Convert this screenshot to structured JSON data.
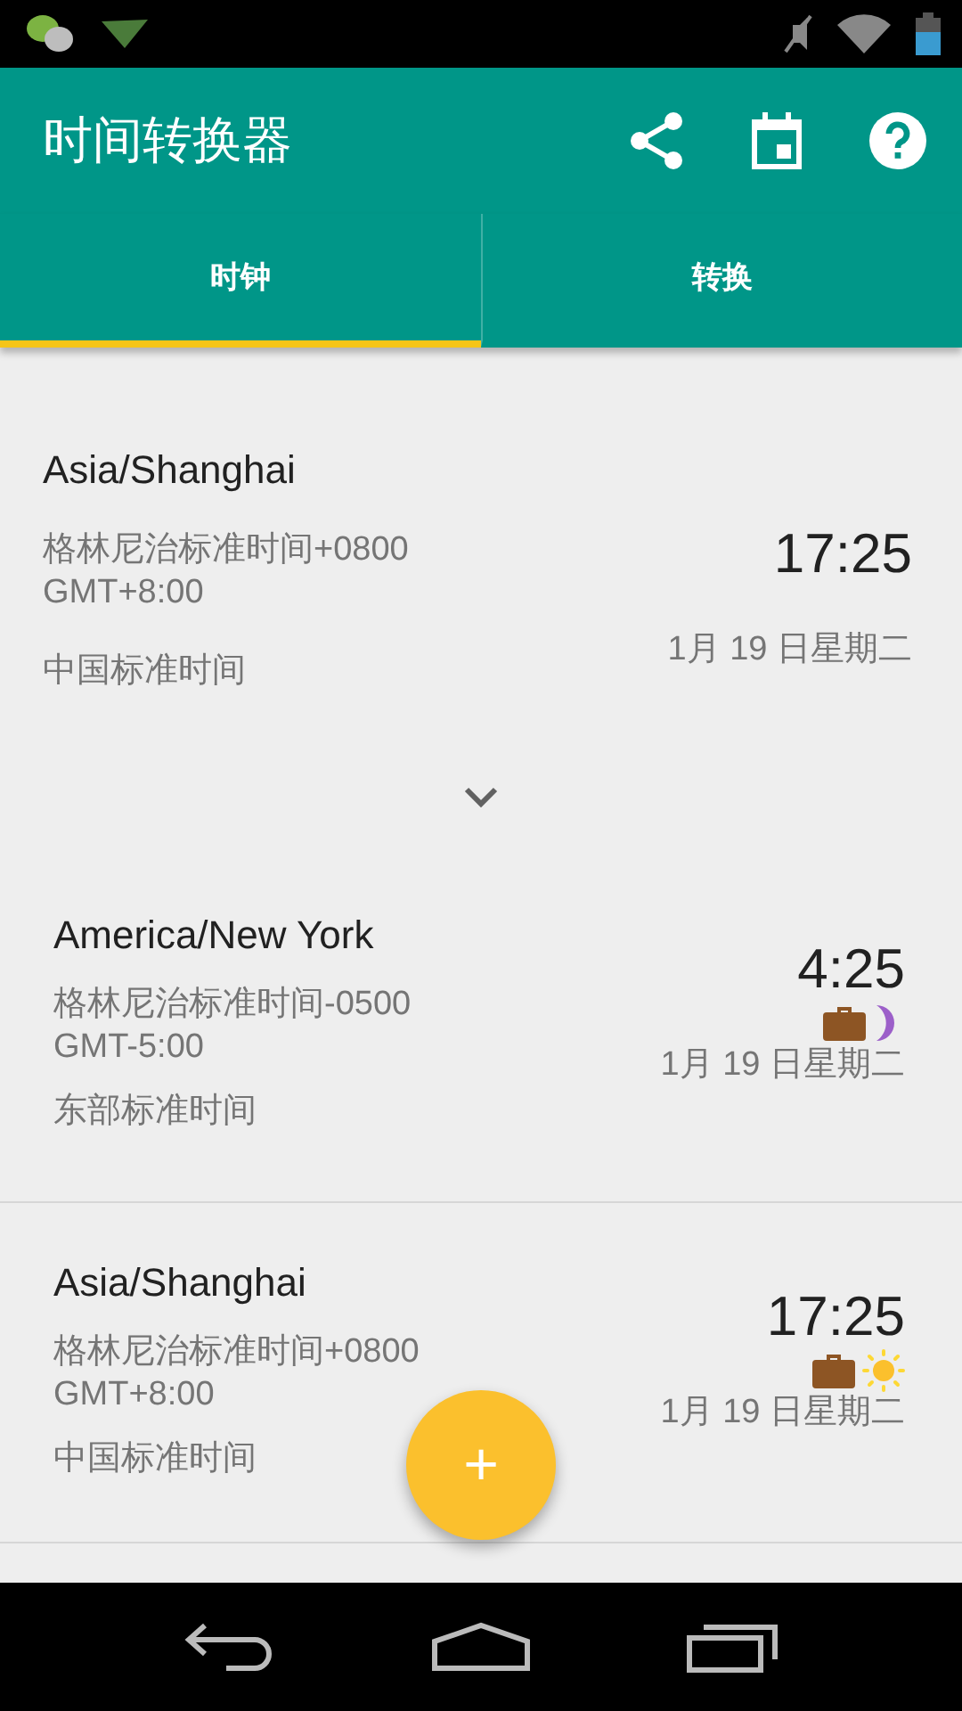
{
  "app_bar": {
    "title": "时间转换器"
  },
  "tabs": [
    {
      "label": "时钟",
      "selected": true
    },
    {
      "label": "转换",
      "selected": false
    }
  ],
  "home_clock": {
    "zone": "Asia/Shanghai",
    "offset": "格林尼治标准时间+0800",
    "gmt": "GMT+8:00",
    "zone_name": "中国标准时间",
    "time": "17:25",
    "date": "1月 19 日星期二",
    "expanded": false
  },
  "clocks": [
    {
      "zone": "America/New York",
      "offset": "格林尼治标准时间-0500",
      "gmt": "GMT-5:00",
      "zone_name": "东部标准时间",
      "time": "4:25",
      "date": "1月 19 日星期二",
      "work_hours": true,
      "daytime": false
    },
    {
      "zone": "Asia/Shanghai",
      "offset": "格林尼治标准时间+0800",
      "gmt": "GMT+8:00",
      "zone_name": "中国标准时间",
      "time": "17:25",
      "date": "1月 19 日星期二",
      "work_hours": true,
      "daytime": true
    }
  ],
  "fab": {
    "label": "+"
  }
}
